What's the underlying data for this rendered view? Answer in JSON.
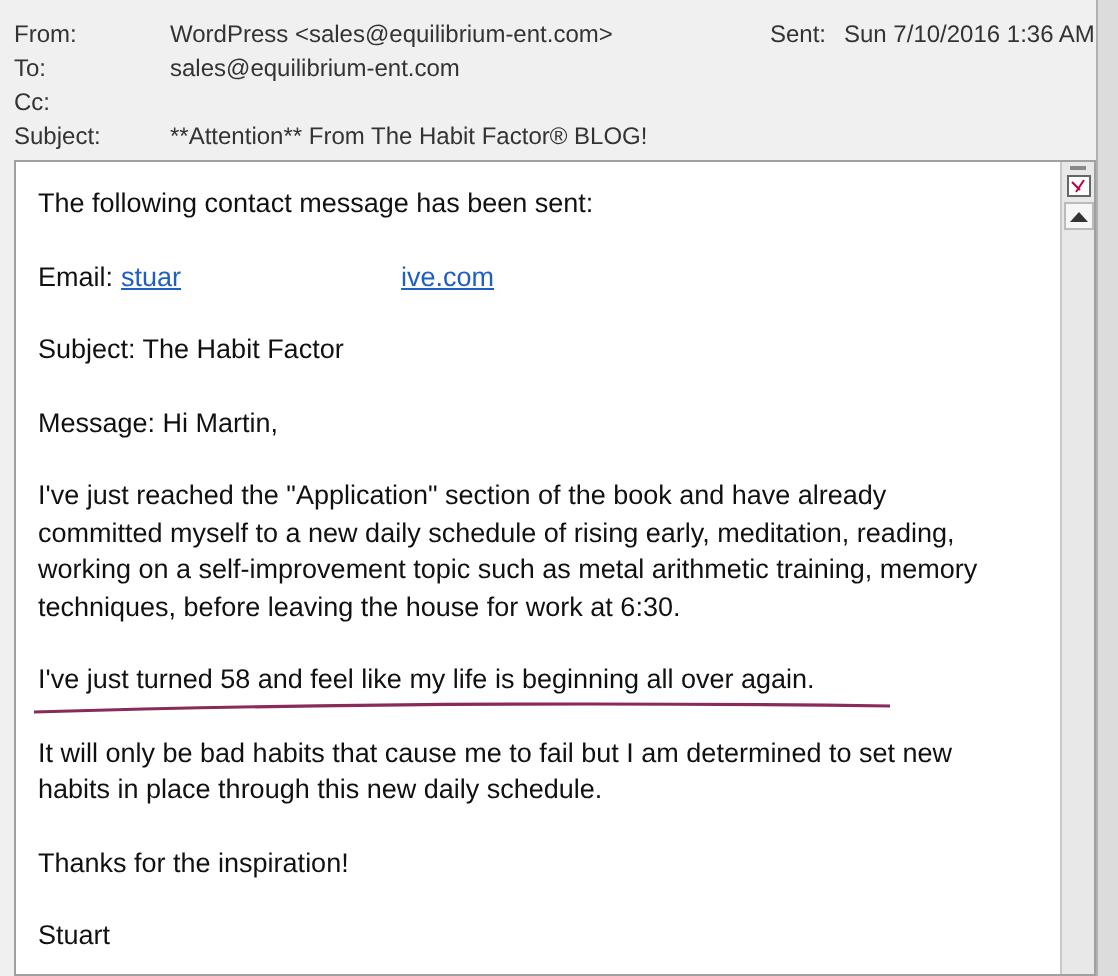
{
  "header": {
    "fields": [
      {
        "label": "From:",
        "value": "WordPress <sales@equilibrium-ent.com>"
      },
      {
        "label": "To:",
        "value": "sales@equilibrium-ent.com"
      },
      {
        "label": "Cc:"
      },
      {
        "label": "Subject:",
        "value": "**Attention** From The Habit Factor® BLOG!"
      }
    ],
    "sent": {
      "label": "Sent:",
      "value": "Sun 7/10/2016 1:36 AM"
    }
  },
  "body": {
    "paragraphs": [
      {
        "kind": "text",
        "text": "The following contact message has been sent:"
      },
      {
        "kind": "email",
        "label": "Email:",
        "links": [
          "stuar",
          "ive.com"
        ]
      },
      {
        "kind": "text",
        "text": "Subject: The Habit Factor"
      },
      {
        "kind": "text",
        "text": "Message: Hi Martin,"
      },
      {
        "kind": "text",
        "text": "I've just reached the \"Application\" section of the book and have already committed myself to a new daily schedule of rising early, meditation, reading, working on a self-improvement topic such as metal arithmetic training, memory techniques, before leaving the house for work at 6:30."
      },
      {
        "kind": "underlined",
        "text": "I've just turned 58 and feel like my life is beginning all over again."
      },
      {
        "kind": "text",
        "text": "It will only be bad habits that cause me to fail but I am determined to set new habits in place through this new daily schedule."
      },
      {
        "kind": "text",
        "text": "Thanks for the inspiration!"
      },
      {
        "kind": "text",
        "text": "Stuart"
      }
    ]
  }
}
